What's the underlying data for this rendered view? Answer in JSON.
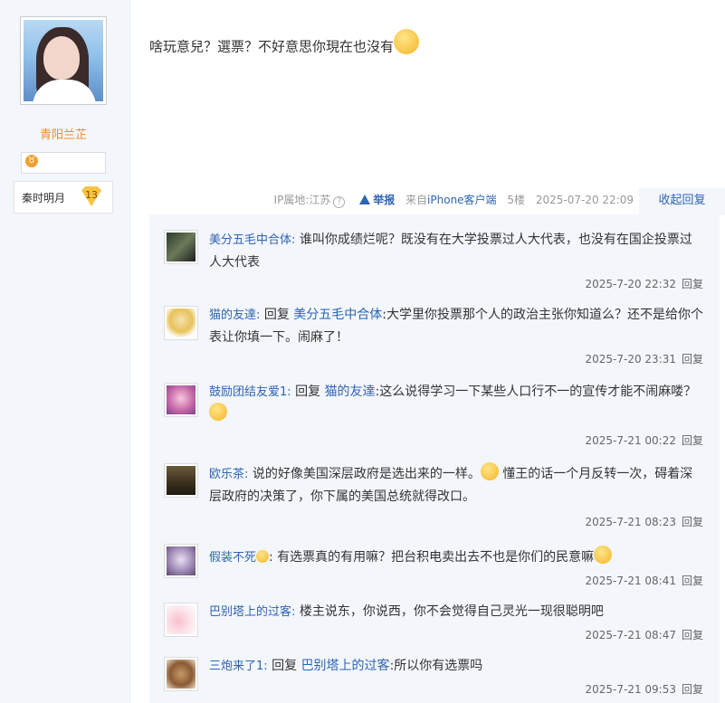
{
  "user": {
    "name": "青阳兰芷",
    "level_name": "秦时明月",
    "level_num": "13"
  },
  "post": {
    "text": "啥玩意兒？選票？不好意思你現在也沒有",
    "meta": {
      "ip": "IP属地:江苏",
      "report": "举报",
      "source_prefix": "来自",
      "device": "iPhone客户端",
      "floor": "5楼",
      "date": "2025-07-20 22:09"
    },
    "collapse_label": "收起回复"
  },
  "comments": [
    {
      "author": "美分五毛中合体:",
      "reply_prefix": "",
      "reply_target": "",
      "text": "谁叫你成绩烂呢？既没有在大学投票过人大代表，也没有在国企投票过人大代表",
      "time": "2025-7-20 22:32",
      "reply": "回复"
    },
    {
      "author": "猫的友達:",
      "reply_prefix": "回复",
      "reply_target": "美分五毛中合体",
      "text": ":大学里你投票那个人的政治主张你知道么？还不是给你个表让你填一下。闹麻了！",
      "time": "2025-7-20 23:31",
      "reply": "回复"
    },
    {
      "author": "鼓励团结友爱1:",
      "reply_prefix": "回复",
      "reply_target": "猫的友達",
      "text": ":这么说得学习一下某些人口行不一的宣传才能不闹麻喽？",
      "time": "2025-7-21 00:22",
      "reply": "回复"
    },
    {
      "author": "欧乐茶:",
      "reply_prefix": "",
      "reply_target": "",
      "text": "说的好像美国深层政府是选出来的一样。",
      "text2": "懂王的话一个月反转一次，碍着深层政府的决策了，你下属的美国总统就得改口。",
      "time": "2025-7-21 08:23",
      "reply": "回复"
    },
    {
      "author": "假装不死",
      "reply_prefix": "",
      "reply_target": "",
      "text": ": 有选票真的有用嘛？把台积电卖出去不也是你们的民意嘛",
      "time": "2025-7-21 08:41",
      "reply": "回复"
    },
    {
      "author": "巴别塔上的过客:",
      "reply_prefix": "",
      "reply_target": "",
      "text": "楼主说东，你说西，你不会觉得自己灵光一现很聪明吧",
      "time": "2025-7-21 08:47",
      "reply": "回复"
    },
    {
      "author": "三炮来了1:",
      "reply_prefix": "回复",
      "reply_target": "巴别塔上的过客",
      "text": ":所以你有选票吗",
      "time": "2025-7-21 09:53",
      "reply": "回复"
    }
  ]
}
